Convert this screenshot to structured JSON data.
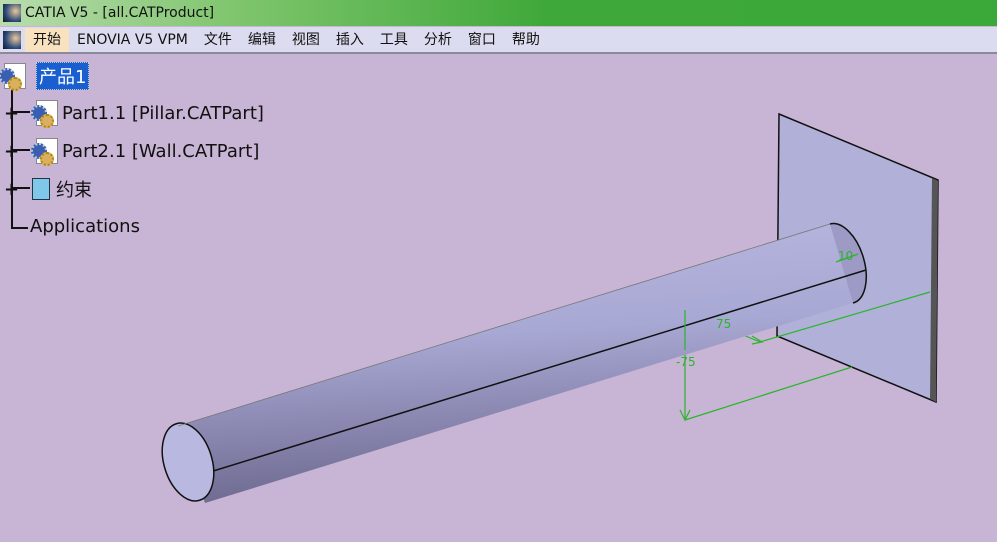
{
  "window": {
    "title": "CATIA V5 - [all.CATProduct]"
  },
  "menu": [
    "开始",
    "ENOVIA V5 VPM",
    "文件",
    "编辑",
    "视图",
    "插入",
    "工具",
    "分析",
    "窗口",
    "帮助"
  ],
  "tree": {
    "root": "产品1",
    "items": [
      {
        "label": "Part1.1 [Pillar.CATPart]"
      },
      {
        "label": "Part2.1 [Wall.CATPart]"
      },
      {
        "label": "约束"
      },
      {
        "label": "Applications"
      }
    ]
  },
  "dimensions": {
    "diameter": "10",
    "offset_x": "75",
    "offset_y": "-75"
  },
  "colors": {
    "background": "#c8b4d4",
    "dimension": "#2ab52a",
    "selection": "#1a5fd0"
  }
}
